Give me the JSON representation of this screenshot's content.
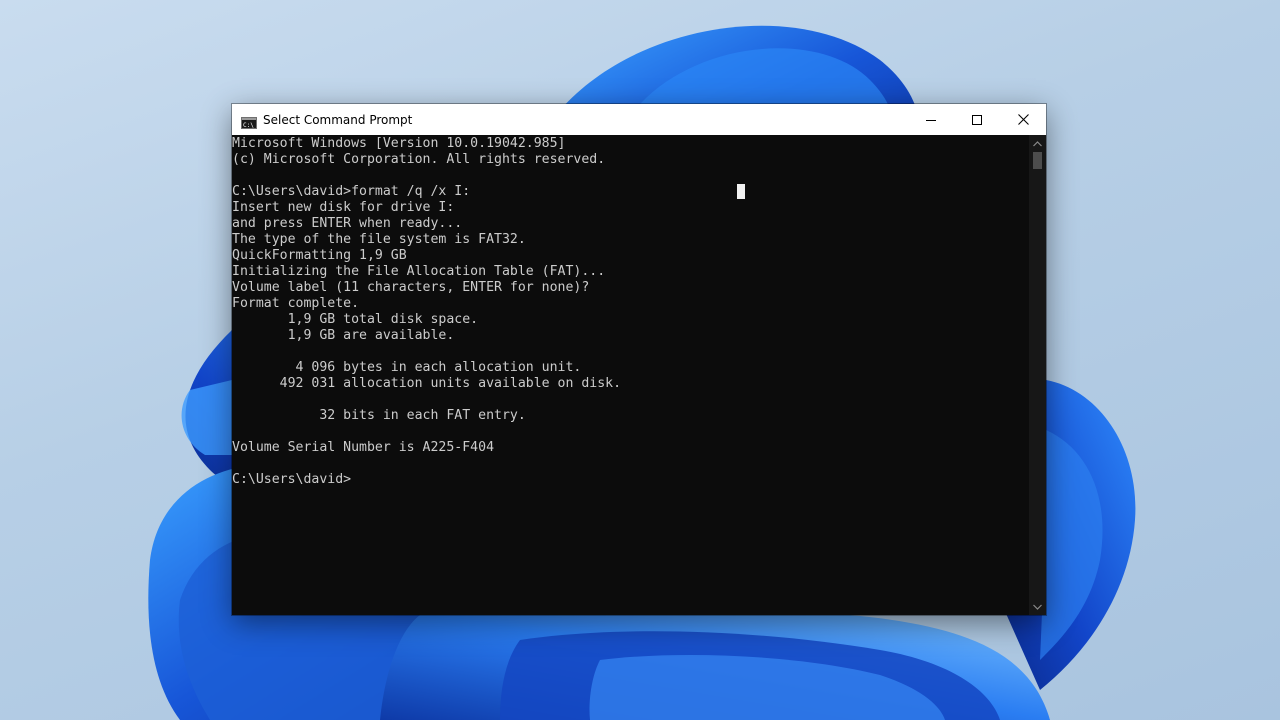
{
  "window": {
    "title": "Select Command Prompt",
    "icon": "cmd-icon"
  },
  "caption_buttons": {
    "minimize_icon": "minimize-icon",
    "maximize_icon": "maximize-icon",
    "close_icon": "close-icon"
  },
  "console": {
    "lines": [
      "Microsoft Windows [Version 10.0.19042.985]",
      "(c) Microsoft Corporation. All rights reserved.",
      "",
      "C:\\Users\\david>format /q /x I:",
      "Insert new disk for drive I:",
      "and press ENTER when ready...",
      "The type of the file system is FAT32.",
      "QuickFormatting 1,9 GB",
      "Initializing the File Allocation Table (FAT)...",
      "Volume label (11 characters, ENTER for none)?",
      "Format complete.",
      "       1,9 GB total disk space.",
      "       1,9 GB are available.",
      "",
      "        4 096 bytes in each allocation unit.",
      "      492 031 allocation units available on disk.",
      "",
      "           32 bits in each FAT entry.",
      "",
      "Volume Serial Number is A225-F404",
      "",
      "C:\\Users\\david>"
    ],
    "background": "#0c0c0c",
    "foreground": "#cccccc"
  },
  "colors": {
    "wallpaper_blue": "#1d5fd6",
    "titlebar": "#ffffff"
  }
}
